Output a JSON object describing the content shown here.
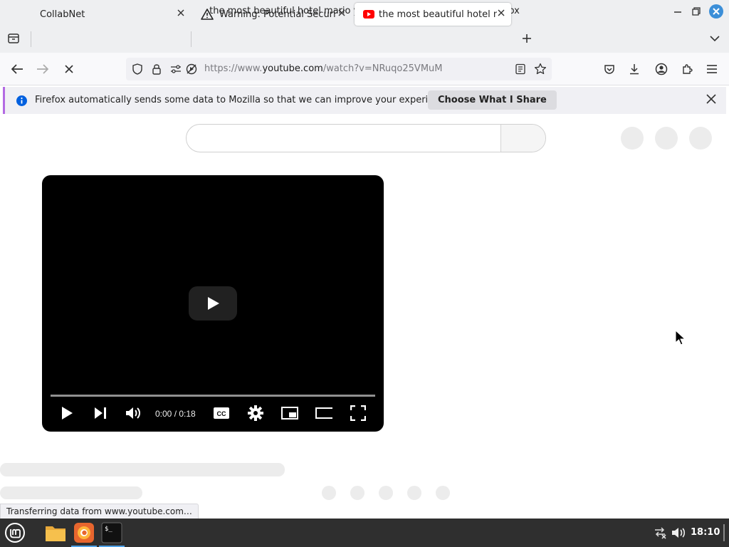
{
  "window": {
    "title": "the most beautiful hotel mario ytp ever - YouTube — Mozilla Firefox"
  },
  "tabs": [
    {
      "label": "CollabNet"
    },
    {
      "label": "Warning: Potential Security Risk Ahead"
    },
    {
      "label": "the most beautiful hotel mario ytp ever - YouTube"
    }
  ],
  "urlbar": {
    "prefix": "https://www.",
    "domain": "youtube.com",
    "path": "/watch?v=NRuqo25VMuM"
  },
  "notification": {
    "message": "Firefox automatically sends some data to Mozilla so that we can improve your experience.",
    "button": "Choose What I Share"
  },
  "player": {
    "time": "0:00 / 0:18",
    "progress": 0
  },
  "statusbar": {
    "text": "Transferring data from www.youtube.com…"
  },
  "taskbar": {
    "clock": "18:10"
  },
  "colors": {
    "accent": "#3c8fd8",
    "youtube_red": "#ff0000",
    "notification_stripe": "#b36ae3",
    "taskbar": "#2f2f2f"
  }
}
